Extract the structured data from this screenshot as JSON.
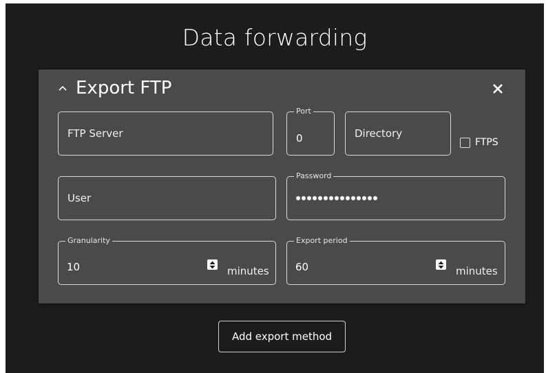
{
  "page": {
    "title": "Data forwarding"
  },
  "card": {
    "title": "Export FTP",
    "ftp_server": {
      "placeholder": "FTP Server",
      "value": ""
    },
    "port": {
      "label": "Port",
      "value": "0"
    },
    "directory": {
      "placeholder": "Directory",
      "value": ""
    },
    "ftps": {
      "label": "FTPS",
      "checked": false
    },
    "user": {
      "placeholder": "User",
      "value": ""
    },
    "password": {
      "label": "Password",
      "masked_length": 15
    },
    "granularity": {
      "label": "Granularity",
      "value": "10",
      "unit": "minutes"
    },
    "export_period": {
      "label": "Export period",
      "value": "60",
      "unit": "minutes"
    }
  },
  "actions": {
    "add_export_method": "Add export method"
  },
  "colors": {
    "page_bg": "#1c1c1c",
    "card_bg": "#4a4a4a",
    "border": "#d9d9d9",
    "text": "#ffffff"
  },
  "icons": {
    "collapse": "chevron-up-icon",
    "close": "close-icon",
    "spinner": "spinner-updown-icon"
  }
}
